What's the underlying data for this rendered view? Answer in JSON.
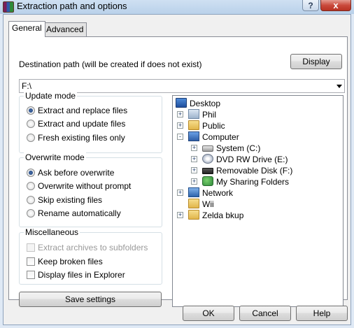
{
  "window": {
    "title": "Extraction path and options",
    "help_glyph": "?",
    "close_glyph": "x"
  },
  "tabs": [
    {
      "label": "General",
      "active": true
    },
    {
      "label": "Advanced",
      "active": false
    }
  ],
  "destination": {
    "label": "Destination path (will be created if does not exist)",
    "value": "F:\\",
    "display_button": "Display"
  },
  "update_mode": {
    "title": "Update mode",
    "options": [
      {
        "label": "Extract and replace files",
        "checked": true
      },
      {
        "label": "Extract and update files",
        "checked": false
      },
      {
        "label": "Fresh existing files only",
        "checked": false
      }
    ]
  },
  "overwrite_mode": {
    "title": "Overwrite mode",
    "options": [
      {
        "label": "Ask before overwrite",
        "checked": true
      },
      {
        "label": "Overwrite without prompt",
        "checked": false
      },
      {
        "label": "Skip existing files",
        "checked": false
      },
      {
        "label": "Rename automatically",
        "checked": false
      }
    ]
  },
  "misc": {
    "title": "Miscellaneous",
    "options": [
      {
        "label": "Extract archives to subfolders",
        "checked": false,
        "disabled": true
      },
      {
        "label": "Keep broken files",
        "checked": false,
        "disabled": false
      },
      {
        "label": "Display files in Explorer",
        "checked": false,
        "disabled": false
      }
    ]
  },
  "save_settings": "Save settings",
  "tree": [
    {
      "label": "Desktop",
      "icon": "desktop-icon",
      "expander": ""
    },
    {
      "label": "Phil",
      "icon": "user-folder-icon",
      "expander": "+"
    },
    {
      "label": "Public",
      "icon": "folder-icon",
      "expander": "+"
    },
    {
      "label": "Computer",
      "icon": "computer-icon",
      "expander": "-"
    },
    {
      "label": "System (C:)",
      "icon": "hard-drive-icon",
      "expander": "+"
    },
    {
      "label": "DVD RW Drive (E:)",
      "icon": "dvd-drive-icon",
      "expander": "+"
    },
    {
      "label": "Removable Disk (F:)",
      "icon": "removable-disk-icon",
      "expander": "+"
    },
    {
      "label": "My Sharing Folders",
      "icon": "sharing-folder-icon",
      "expander": "+"
    },
    {
      "label": "Network",
      "icon": "network-icon",
      "expander": "+"
    },
    {
      "label": "Wii",
      "icon": "folder-icon",
      "expander": ""
    },
    {
      "label": "Zelda bkup",
      "icon": "folder-icon",
      "expander": "+"
    }
  ],
  "footer": {
    "ok": "OK",
    "cancel": "Cancel",
    "help": "Help"
  }
}
